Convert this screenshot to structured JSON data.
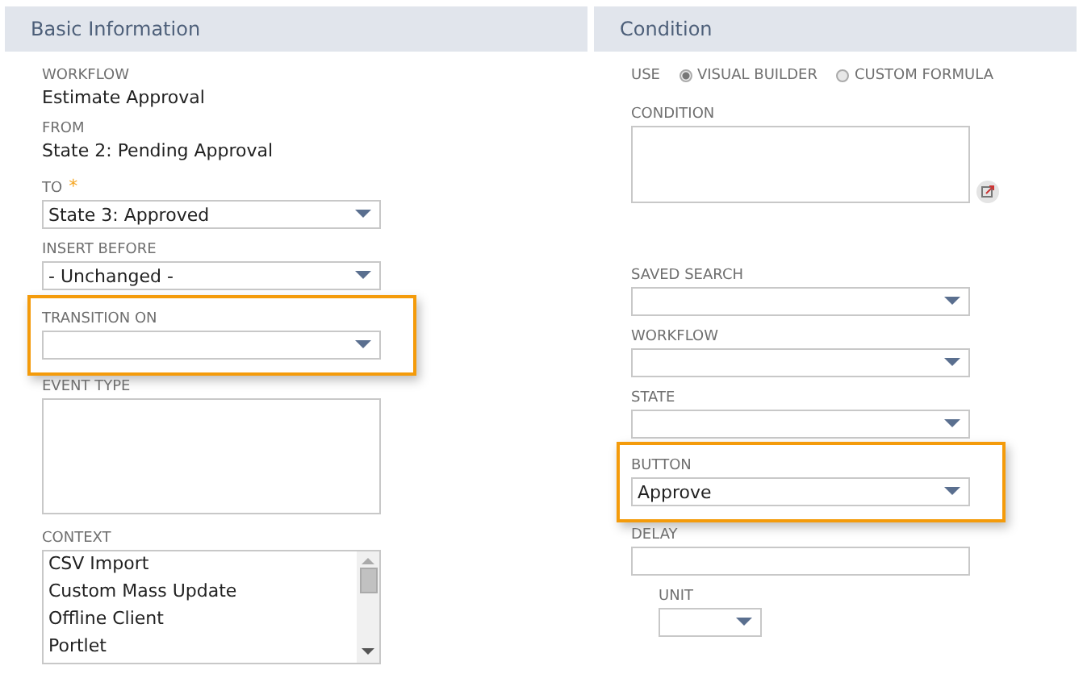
{
  "basic_information": {
    "title": "Basic Information",
    "fields": [
      {
        "kind": "text",
        "label": "WORKFLOW",
        "value": "Estimate Approval"
      },
      {
        "kind": "text",
        "label": "FROM",
        "value": "State 2: Pending Approval"
      },
      {
        "kind": "select",
        "label": "TO",
        "required_mark": "*",
        "value": "State 3: Approved"
      },
      {
        "kind": "select",
        "label": "INSERT BEFORE",
        "value": "- Unchanged -"
      },
      {
        "kind": "select",
        "label": "TRANSITION ON",
        "highlighted": true
      },
      {
        "kind": "textarea",
        "label": "EVENT TYPE"
      },
      {
        "kind": "listbox",
        "label": "CONTEXT",
        "options": [
          "CSV Import",
          "Custom Mass Update",
          "Offline Client",
          "Portlet"
        ]
      }
    ]
  },
  "condition": {
    "title": "Condition",
    "use": {
      "label": "USE",
      "options": [
        {
          "label": "VISUAL BUILDER",
          "selected": true
        },
        {
          "label": "CUSTOM FORMULA",
          "selected": false
        }
      ]
    },
    "fields": [
      {
        "kind": "condition",
        "label": "CONDITION"
      },
      {
        "kind": "select",
        "label": "SAVED SEARCH"
      },
      {
        "kind": "select",
        "label": "WORKFLOW"
      },
      {
        "kind": "select",
        "label": "STATE"
      },
      {
        "kind": "select",
        "label": "BUTTON",
        "value": "Approve",
        "highlighted": true
      },
      {
        "kind": "input",
        "label": "DELAY"
      },
      {
        "kind": "unit",
        "label": "UNIT"
      }
    ]
  }
}
